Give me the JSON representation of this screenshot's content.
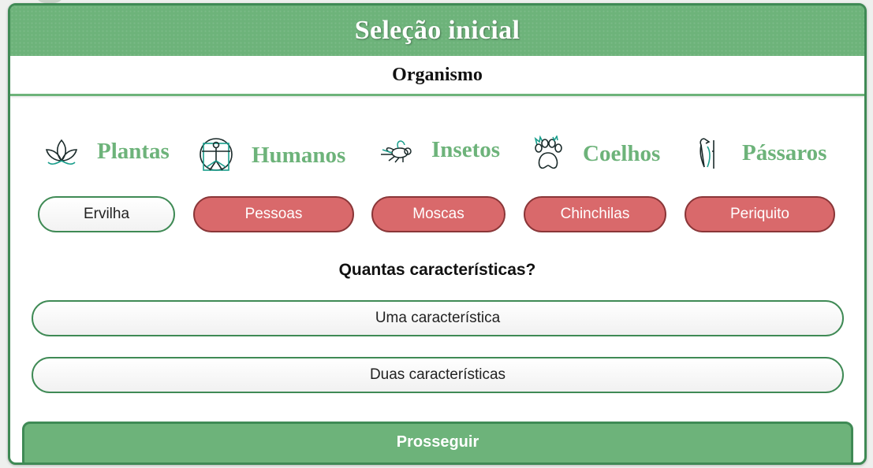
{
  "header": {
    "title": "Seleção inicial"
  },
  "section": {
    "title": "Organismo"
  },
  "categories": [
    {
      "label": "Plantas",
      "icon": "lotus-icon",
      "option": "Ervilha",
      "selected": true
    },
    {
      "label": "Humanos",
      "icon": "vitruvian-man-icon",
      "option": "Pessoas",
      "selected": false
    },
    {
      "label": "Insetos",
      "icon": "fly-icon",
      "option": "Moscas",
      "selected": false
    },
    {
      "label": "Coelhos",
      "icon": "paw-icon",
      "option": "Chinchilas",
      "selected": false
    },
    {
      "label": "Pássaros",
      "icon": "bird-icon",
      "option": "Periquito",
      "selected": false
    }
  ],
  "question": "Quantas características?",
  "options": [
    {
      "label": "Uma característica"
    },
    {
      "label": "Duas características"
    }
  ],
  "proceed": {
    "label": "Prosseguir"
  },
  "colors": {
    "accent_green": "#6db37a",
    "border_green": "#3f8a55",
    "unselected_red": "#d9696b",
    "icon_teal": "#1a9e8c"
  }
}
